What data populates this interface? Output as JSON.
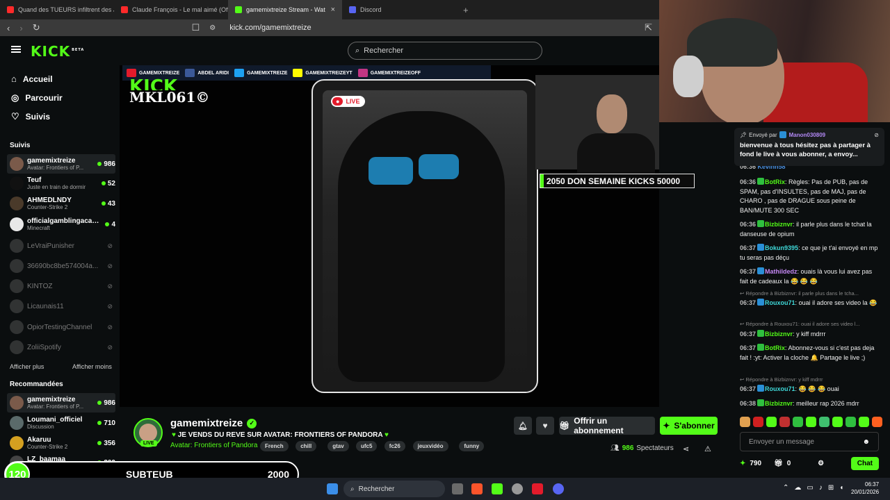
{
  "browser": {
    "tabs": [
      {
        "title": "Quand des TUEURS infiltrent des JEU",
        "color": "#ff2a2a"
      },
      {
        "title": "Claude François - Le mal aimé (Offici",
        "color": "#ff2a2a"
      },
      {
        "title": "gamemixtreize Stream - Wat",
        "color": "#53fc18",
        "active": true
      },
      {
        "title": "Discord",
        "color": "#5865f2"
      }
    ],
    "url": "kick.com/gamemixtreize"
  },
  "header": {
    "logo": "KICK",
    "logo_sup": "BETA",
    "search_placeholder": "Rechercher"
  },
  "sidebar": {
    "nav": [
      {
        "label": "Accueil",
        "icon": "home-icon"
      },
      {
        "label": "Parcourir",
        "icon": "compass-icon"
      },
      {
        "label": "Suivis",
        "icon": "heart-icon"
      }
    ],
    "followed_title": "Suivis",
    "followed": [
      {
        "name": "gamemixtreize",
        "game": "Avatar: Frontiers of P...",
        "viewers": "986",
        "live": true,
        "selected": true,
        "color": "#7a5a4a"
      },
      {
        "name": "Teuf",
        "game": "Juste en train de dormir",
        "viewers": "52",
        "live": true,
        "color": "#111"
      },
      {
        "name": "AHMEDLNDY",
        "game": "Counter-Strike 2",
        "viewers": "43",
        "live": true,
        "color": "#4a3a2a"
      },
      {
        "name": "officialgamblingacad...",
        "game": "Minecraft",
        "viewers": "4",
        "live": true,
        "color": "#e8e8e8"
      },
      {
        "name": "LeVraiPunisher",
        "live": false,
        "color": "#777"
      },
      {
        "name": "36690bc8be574004a...",
        "live": false,
        "color": "#777"
      },
      {
        "name": "KINTOZ",
        "live": false,
        "color": "#777"
      },
      {
        "name": "Licaunais11",
        "live": false,
        "color": "#777"
      },
      {
        "name": "OpiorTestingChannel",
        "live": false,
        "color": "#777"
      },
      {
        "name": "ZoliiSpotify",
        "live": false,
        "color": "#777"
      }
    ],
    "show_more": "Afficher plus",
    "show_less": "Afficher moins",
    "recommended_title": "Recommandées",
    "recommended": [
      {
        "name": "gamemixtreize",
        "game": "Avatar: Frontiers of P...",
        "viewers": "986",
        "selected": true,
        "color": "#7a5a4a"
      },
      {
        "name": "Loumani_officiel",
        "game": "Discussion",
        "viewers": "710",
        "color": "#5a6a6a"
      },
      {
        "name": "Akaruu",
        "game": "Counter-Strike 2",
        "viewers": "356",
        "color": "#d4a020"
      },
      {
        "name": "LZ_baamaa",
        "game": "Grand Theft Auto V (G...",
        "viewers": "200",
        "color": "#444"
      }
    ]
  },
  "video": {
    "socials": [
      {
        "icon": "youtube-icon",
        "label": "GAMEMIXTREIZE",
        "color": "#e31b2b"
      },
      {
        "icon": "facebook-icon",
        "label": "ABDEL ARIDI",
        "color": "#3b5998",
        "sub": "FACEBOOK"
      },
      {
        "icon": "twitter-icon",
        "label": "GAMEMIXTREIZE",
        "color": "#1da1f2",
        "sub": "TWITTER"
      },
      {
        "icon": "snapchat-icon",
        "label": "GAMEMIXTREIZEYT",
        "color": "#fffc00",
        "sub": "SNAPCHAT"
      },
      {
        "icon": "instagram-icon",
        "label": "GAMEMIXTREIZEOFF",
        "color": "#c13584",
        "sub": "INSTAGRAM"
      }
    ],
    "watermark_kick": "KICK",
    "watermark": "MKL061©",
    "live_badge": "LIVE",
    "kicks_bar": "2050  DON SEMAINE KICKS 50000"
  },
  "stream": {
    "channel": "gamemixtreize",
    "live_tag": "LIVE",
    "title": "JE VENDS DU REVE SUR AVATAR: FRONTIERS OF PANDORA",
    "category": "Avatar: Frontiers of Pandora",
    "tags": [
      "French",
      "chill",
      "gtav",
      "ufc5",
      "fc26",
      "jeuxvidéo",
      "funny"
    ],
    "gift_label": "Offrir un abonnement",
    "subscribe_label": "S'abonner",
    "viewers": "986",
    "viewers_label": "Spectateurs"
  },
  "chat": {
    "pinned": {
      "by_label": "Envoyé par",
      "user": "Manon030809",
      "text": "bienvenue à tous hésitez pas à partager à fond le live à vous abonner, a envoy..."
    },
    "partial_row": {
      "time": "06:36",
      "user": "Kevinn58"
    },
    "messages": [
      {
        "time": "06:36",
        "user": "BotRix",
        "color": "#53fc18",
        "text": "Règles: Pas de PUB, pas de SPAM, pas d'INSULTES, pas de MAJ, pas de CHARO , pas de DRAGUE sous peine de BAN/MUTE 300 SEC"
      },
      {
        "time": "06:36",
        "user": "Bizbiznvr",
        "color": "#53fc18",
        "text": "il parle plus dans le tchat la danseuse de opium"
      },
      {
        "time": "06:37",
        "user": "Bokun9395",
        "color": "#3fd8d8",
        "text": "ce que je t'ai envoyé en mp tu seras pas déçu"
      },
      {
        "time": "06:37",
        "user": "Mathildedz",
        "color": "#c588f5",
        "text": "ouais là vous lui avez pas fait de cadeaux la 😂 😂 😂"
      },
      {
        "time": "06:37",
        "user": "Rouxou71",
        "color": "#3fd8d8",
        "text": "ouai il adore ses video la 😂",
        "reply": "Répondre à Bizbiznvr: il parle plus dans le tcha..."
      },
      {
        "time": "06:37",
        "user": "Bizbiznvr",
        "color": "#53fc18",
        "text": "y kiff mdrrr",
        "reply": "Répondre à Rouxou71: ouai il adore ses video l..."
      },
      {
        "time": "06:37",
        "user": "BotRix",
        "color": "#53fc18",
        "text": "Abonnez-vous si c'est pas deja fait ! :yt: Activer la cloche 🔔 Partage le live ;)"
      },
      {
        "time": "06:37",
        "user": "Rouxou71",
        "color": "#3fd8d8",
        "text": "😂 😂 😂 ouai",
        "reply": "Répondre à Bizbiznvr: y kiff mdrrr"
      },
      {
        "time": "06:38",
        "user": "Bizbiznvr",
        "color": "#53fc18",
        "text": "meilleur rap 2026 mdrr"
      }
    ],
    "emote_colors": [
      "#e0a050",
      "#d02020",
      "#53fc18",
      "#c03030",
      "#2fbf3f",
      "#53fc18",
      "#3fbf6f",
      "#53fc18",
      "#2fbf3f",
      "#53fc18",
      "#ff6020"
    ],
    "input_placeholder": "Envoyer un message",
    "kicks": "790",
    "gifts": "0",
    "chat_btn": "Chat"
  },
  "subgoal": {
    "count": "120",
    "label": "SUBTEUB",
    "target": "2000"
  },
  "taskbar": {
    "search": "Rechercher",
    "time": "06:37",
    "date": "20/01/2026"
  }
}
